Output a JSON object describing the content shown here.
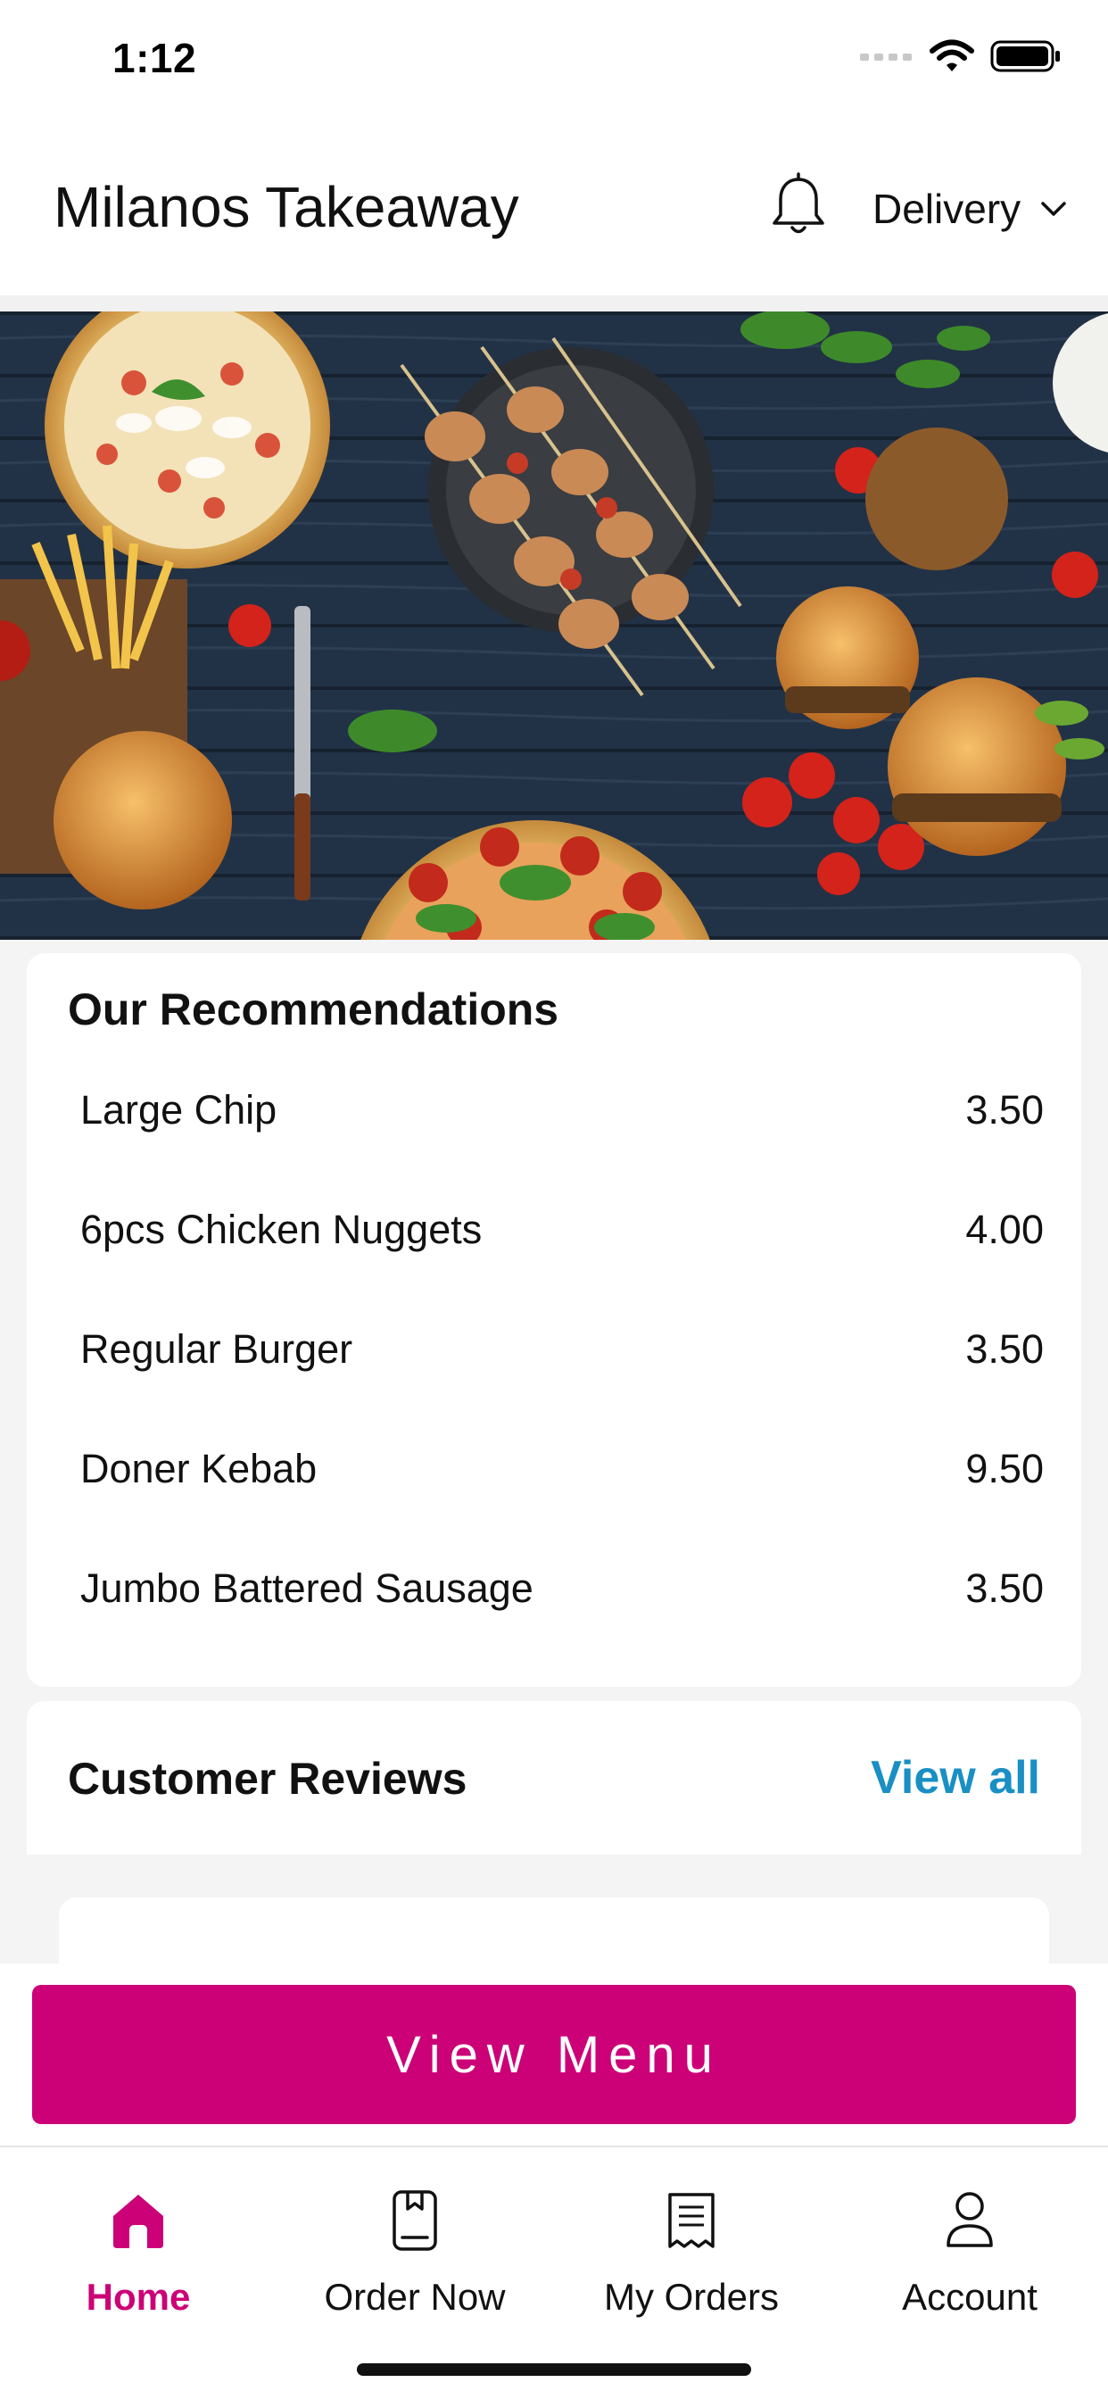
{
  "status_bar": {
    "time": "1:12"
  },
  "header": {
    "title": "Milanos Takeaway",
    "delivery_mode": "Delivery"
  },
  "hero": {
    "icon": "food-banner-image"
  },
  "recommendations": {
    "title": "Our Recommendations",
    "items": [
      {
        "name": "Large Chip",
        "price": "3.50"
      },
      {
        "name": "6pcs Chicken Nuggets",
        "price": "4.00"
      },
      {
        "name": "Regular Burger",
        "price": "3.50"
      },
      {
        "name": "Doner Kebab",
        "price": "9.50"
      },
      {
        "name": "Jumbo Battered Sausage",
        "price": "3.50"
      }
    ]
  },
  "reviews": {
    "title": "Customer Reviews",
    "view_all": "View all"
  },
  "view_menu": {
    "label": "View Menu"
  },
  "bottom_nav": {
    "items": [
      {
        "label": "Home",
        "icon": "home-icon",
        "active": true
      },
      {
        "label": "Order Now",
        "icon": "order-book-icon",
        "active": false
      },
      {
        "label": "My Orders",
        "icon": "receipt-icon",
        "active": false
      },
      {
        "label": "Account",
        "icon": "user-icon",
        "active": false
      }
    ]
  },
  "colors": {
    "accent": "#cc0077",
    "link": "#1a8fc4",
    "hero_bg": "#1f2c3c"
  }
}
